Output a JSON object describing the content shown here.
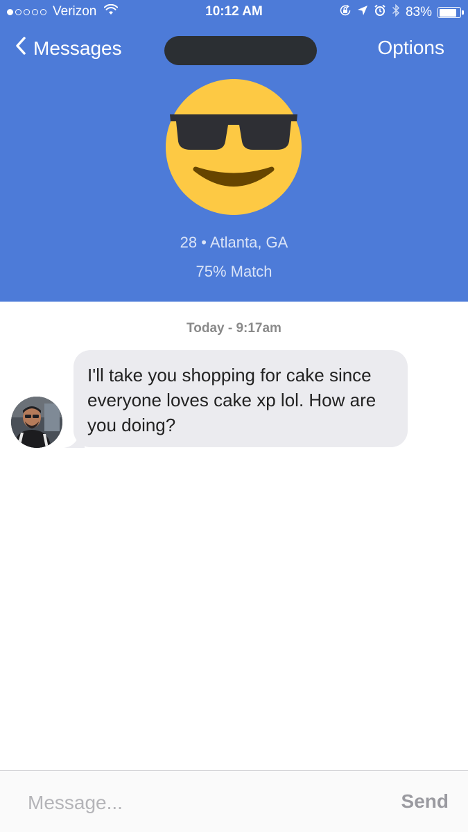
{
  "status_bar": {
    "carrier": "Verizon",
    "signal_strength_dots": "1 of 5",
    "time": "10:12 AM",
    "battery_percent": "83%",
    "battery_level": 0.83,
    "icons": [
      "wifi-icon",
      "orientation-lock-icon",
      "location-arrow-icon",
      "alarm-icon",
      "bluetooth-icon",
      "battery-icon"
    ]
  },
  "nav": {
    "back_label": "Messages",
    "options_label": "Options"
  },
  "profile": {
    "avatar_icon": "sunglasses-emoji-icon",
    "age_location": "28 • Atlanta, GA",
    "match": "75% Match"
  },
  "conversation": {
    "timestamp": "Today - 9:17am",
    "messages": [
      {
        "text": "I'll take you shopping for cake since everyone loves cake xp lol. How are you doing?"
      }
    ]
  },
  "composer": {
    "placeholder": "Message...",
    "send_label": "Send"
  },
  "colors": {
    "header_blue": "#4d7bd8",
    "bubble_gray": "#ebebef",
    "emoji_yellow": "#fdc944"
  }
}
